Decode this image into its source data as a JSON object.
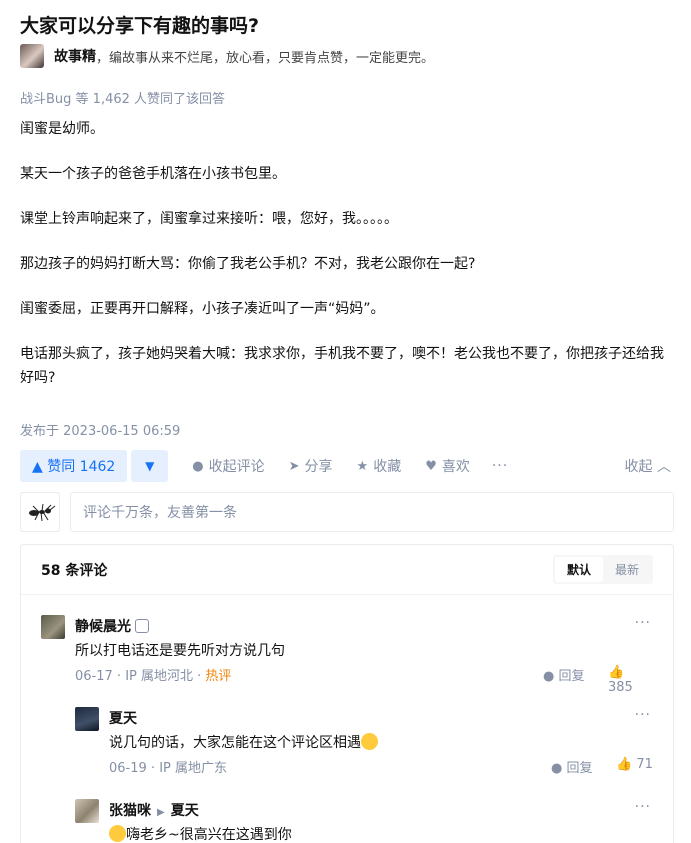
{
  "question": {
    "title": "大家可以分享下有趣的事吗?"
  },
  "author": {
    "name": "故事精",
    "bio": "，编故事从来不烂尾，放心看，只要肯点赞，一定能更完。"
  },
  "voters": "战斗Bug 等 1,462 人赞同了该回答",
  "content": [
    "闺蜜是幼师。",
    "某天一个孩子的爸爸手机落在小孩书包里。",
    "课堂上铃声响起来了，闺蜜拿过来接听：喂，您好，我。。。。。",
    "那边孩子的妈妈打断大骂：你偷了我老公手机？不对，我老公跟你在一起?",
    "闺蜜委屈，正要再开口解释，小孩子凑近叫了一声“妈妈”。",
    "电话那头疯了，孩子她妈哭着大喊：我求求你，手机我不要了，噢不！老公我也不要了，你把孩子还给我好吗?"
  ],
  "pubdate": "发布于 2023-06-15 06:59",
  "actions": {
    "vote_up": "▲ 赞同 1462",
    "vote_down": "▼",
    "collapse_comments": "收起评论",
    "share": "分享",
    "favorite": "收藏",
    "like": "喜欢",
    "more": "···",
    "collapse": "收起 ︿"
  },
  "comment_input": {
    "placeholder": "评论千万条，友善第一条"
  },
  "comments": {
    "count": "58 条评论",
    "sort": [
      "默认",
      "最新"
    ],
    "items": [
      {
        "user": "静候晨光",
        "text": "所以打电话还是要先听对方说几句",
        "date": "06-17",
        "location": "IP 属地河北",
        "tag": "热评",
        "reply": "回复",
        "likes": "385"
      },
      {
        "user": "夏天",
        "text": "说几句的话，大家怎能在这个评论区相遇",
        "date": "06-19",
        "location": "IP 属地广东",
        "reply": "回复",
        "likes": "71"
      },
      {
        "user": "张猫咪",
        "reply_to": "夏天",
        "text": "嗨老乡~很高兴在这遇到你"
      }
    ]
  },
  "icons": {
    "comment": "comment-icon",
    "share": "share-icon",
    "favorite": "star-icon",
    "like": "heart-icon",
    "reply": "reply-icon",
    "thumb": "thumb-up-icon"
  },
  "colors": {
    "accent": "#1772f6",
    "accent_bg": "#e5effe",
    "muted": "#8590a6",
    "hot": "#f1850a"
  }
}
